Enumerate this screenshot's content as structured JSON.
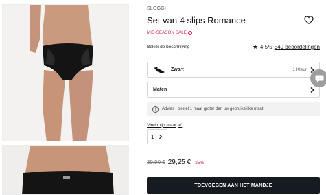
{
  "product": {
    "brand": "SLOGGI",
    "title": "Set van 4 slips Romance",
    "sale_badge": "MID-SEASON SALE",
    "sale_info_glyph": "i",
    "description_link": "Bekijk de beschrijving",
    "rating_value": "4,5/5",
    "reviews_link": "549 beoordelingen",
    "star_glyph": "★",
    "heart_icon": "heart-outline-icon"
  },
  "colour_selector": {
    "name": "Zwart",
    "more": "+ 1 Kleur",
    "swatch_color": "#111111"
  },
  "size_selector": {
    "label": "Maten"
  },
  "advice": {
    "icon_glyph": "i",
    "text": "Advies : bestel 1 maat groter dan uw gebruikelijke maat"
  },
  "find_size": {
    "label": "Vind mijn maat",
    "icon_glyph": "✐"
  },
  "quantity": {
    "value": "1"
  },
  "price": {
    "old": "39,90 €",
    "current": "29,25 €",
    "discount": "-25%"
  },
  "cta": {
    "label": "TOEVOEGEN AAN HET MANDJE"
  },
  "colors": {
    "sale": "#d4214d",
    "button_bg": "#161b22",
    "chat_bubble": "#9e9e9e"
  }
}
